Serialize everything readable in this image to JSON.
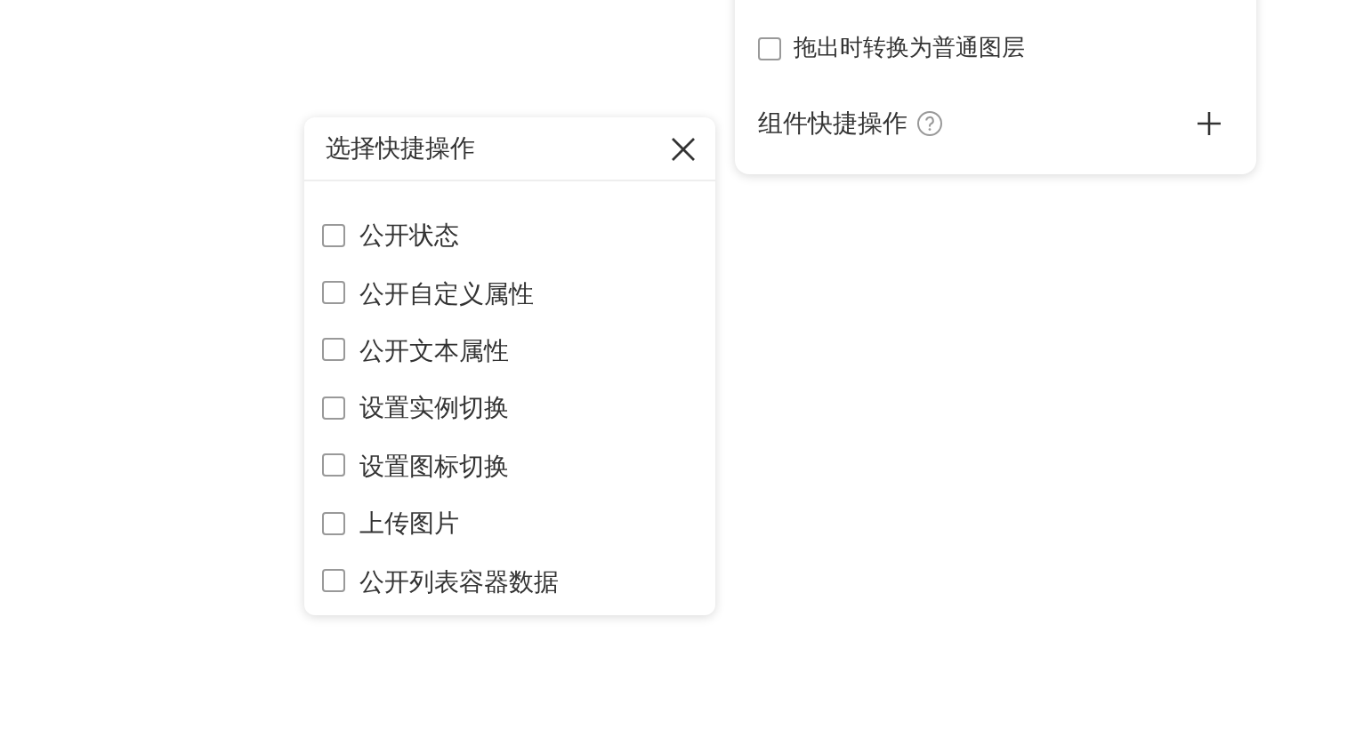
{
  "settings_panel": {
    "convert_option": {
      "label": "拖出时转换为普通图层",
      "checked": false
    },
    "section_title": "组件快捷操作"
  },
  "quick_action_popup": {
    "title": "选择快捷操作",
    "options": [
      {
        "label": "公开状态",
        "checked": false
      },
      {
        "label": "公开自定义属性",
        "checked": false
      },
      {
        "label": "公开文本属性",
        "checked": false
      },
      {
        "label": "设置实例切换",
        "checked": false
      },
      {
        "label": "设置图标切换",
        "checked": false
      },
      {
        "label": "上传图片",
        "checked": false
      },
      {
        "label": "公开列表容器数据",
        "checked": false
      }
    ]
  }
}
